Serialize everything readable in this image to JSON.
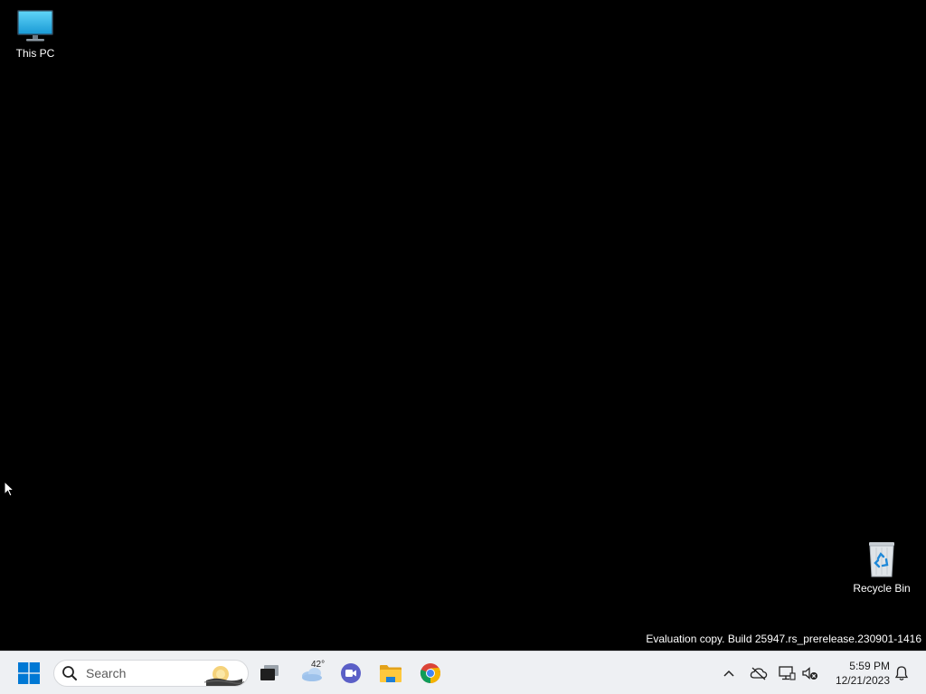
{
  "desktop": {
    "icons": [
      {
        "label": "This PC",
        "icon": "monitor-icon"
      },
      {
        "label": "Recycle Bin",
        "icon": "recycle-bin-icon"
      }
    ],
    "watermark": "Evaluation copy. Build 25947.rs_prerelease.230901-1416"
  },
  "taskbar": {
    "start_icon": "windows-logo-icon",
    "search": {
      "placeholder": "Search",
      "icon": "search-icon"
    },
    "weather": {
      "temperature": "42°",
      "icon": "cloudy-weather-icon"
    },
    "pinned": [
      {
        "name": "Task View",
        "icon": "task-view-icon"
      },
      {
        "name": "Widgets",
        "icon": "weather-icon"
      },
      {
        "name": "Meet",
        "icon": "video-camera-icon"
      },
      {
        "name": "File Explorer",
        "icon": "folder-icon"
      },
      {
        "name": "Google Chrome",
        "icon": "chrome-icon"
      }
    ],
    "tray": {
      "icons": [
        "chevron-up-icon",
        "cloud-offline-icon",
        "network-icon",
        "volume-muted-icon",
        "bell-icon"
      ]
    },
    "clock": {
      "time": "5:59 PM",
      "date": "12/21/2023"
    }
  },
  "colors": {
    "desktop_bg": "#000000",
    "taskbar_bg": "#eef0f3",
    "windows_blue": "#0078d4"
  }
}
